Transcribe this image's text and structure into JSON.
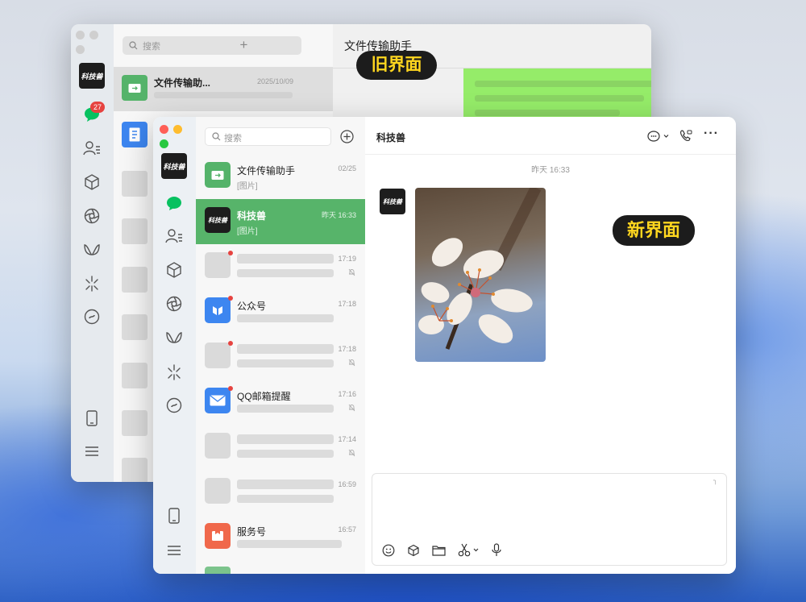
{
  "old_window": {
    "search_placeholder": "搜索",
    "chat_title": "文件传输助手",
    "unread_badge": "27",
    "first_item_name": "文件传输助...",
    "first_item_time": "2025/10/09",
    "avatar_text": "科技兽"
  },
  "new_window": {
    "search_placeholder": "搜索",
    "chat_title": "科技兽",
    "message_time": "昨天 16:33",
    "avatar_text": "科技兽",
    "chats": [
      {
        "name": "文件传输助手",
        "time": "02/25",
        "preview": "[图片]"
      },
      {
        "name": "科技兽",
        "time": "昨天 16:33",
        "preview": "[图片]"
      },
      {
        "name": "",
        "time": "17:19",
        "preview": ""
      },
      {
        "name": "公众号",
        "time": "17:18",
        "preview": ""
      },
      {
        "name": "",
        "time": "17:18",
        "preview": ""
      },
      {
        "name": "QQ邮箱提醒",
        "time": "17:16",
        "preview": ""
      },
      {
        "name": "",
        "time": "17:14",
        "preview": ""
      },
      {
        "name": "",
        "time": "16:59",
        "preview": ""
      },
      {
        "name": "服务号",
        "time": "16:57",
        "preview": ""
      }
    ]
  },
  "labels": {
    "old": "旧界面",
    "new": "新界面"
  },
  "colors": {
    "selected_row": "#57b46a",
    "wechat_green": "#07c160",
    "label_bg": "#1c1c1c",
    "label_text": "#ffd61f"
  }
}
